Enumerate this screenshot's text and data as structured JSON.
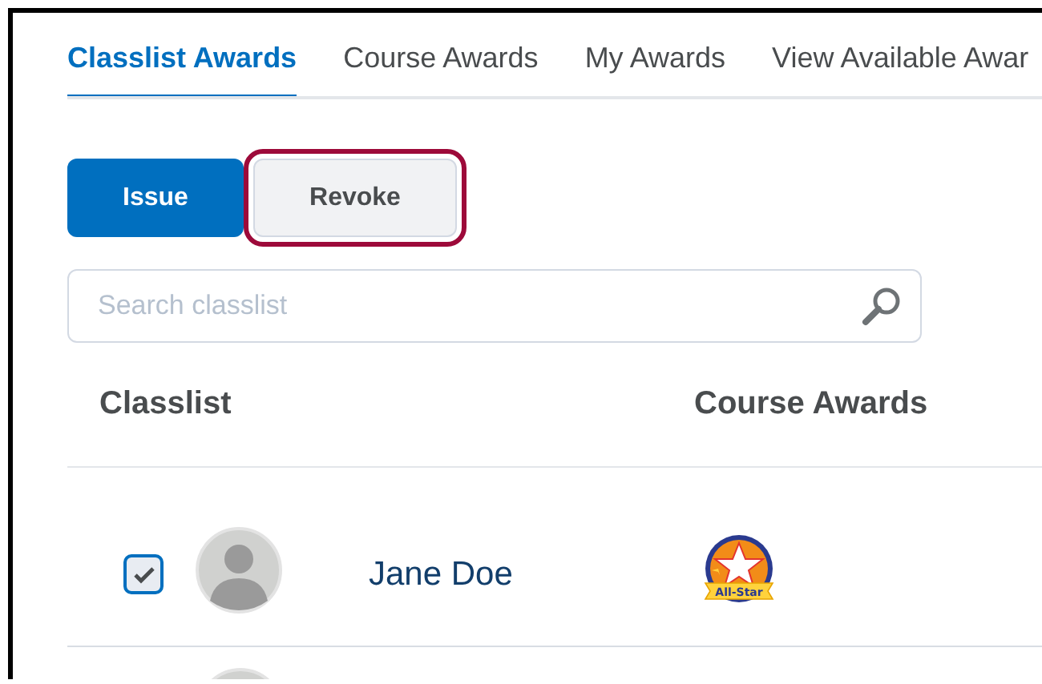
{
  "tabs": [
    {
      "label": "Classlist Awards",
      "selected": true
    },
    {
      "label": "Course Awards",
      "selected": false
    },
    {
      "label": "My Awards",
      "selected": false
    },
    {
      "label": "View Available Awar",
      "selected": false
    }
  ],
  "buttons": [
    {
      "label": "Issue",
      "kind": "primary",
      "highlighted": false
    },
    {
      "label": "Revoke",
      "kind": "secondary",
      "highlighted": true
    }
  ],
  "search": {
    "placeholder": "Search classlist"
  },
  "table": {
    "columns": [
      "Classlist",
      "Course Awards"
    ],
    "rows": [
      {
        "kind": "student",
        "checked": true,
        "name": "Jane Doe",
        "award_label": "All-Star"
      },
      {
        "kind": "cut_off"
      }
    ]
  }
}
